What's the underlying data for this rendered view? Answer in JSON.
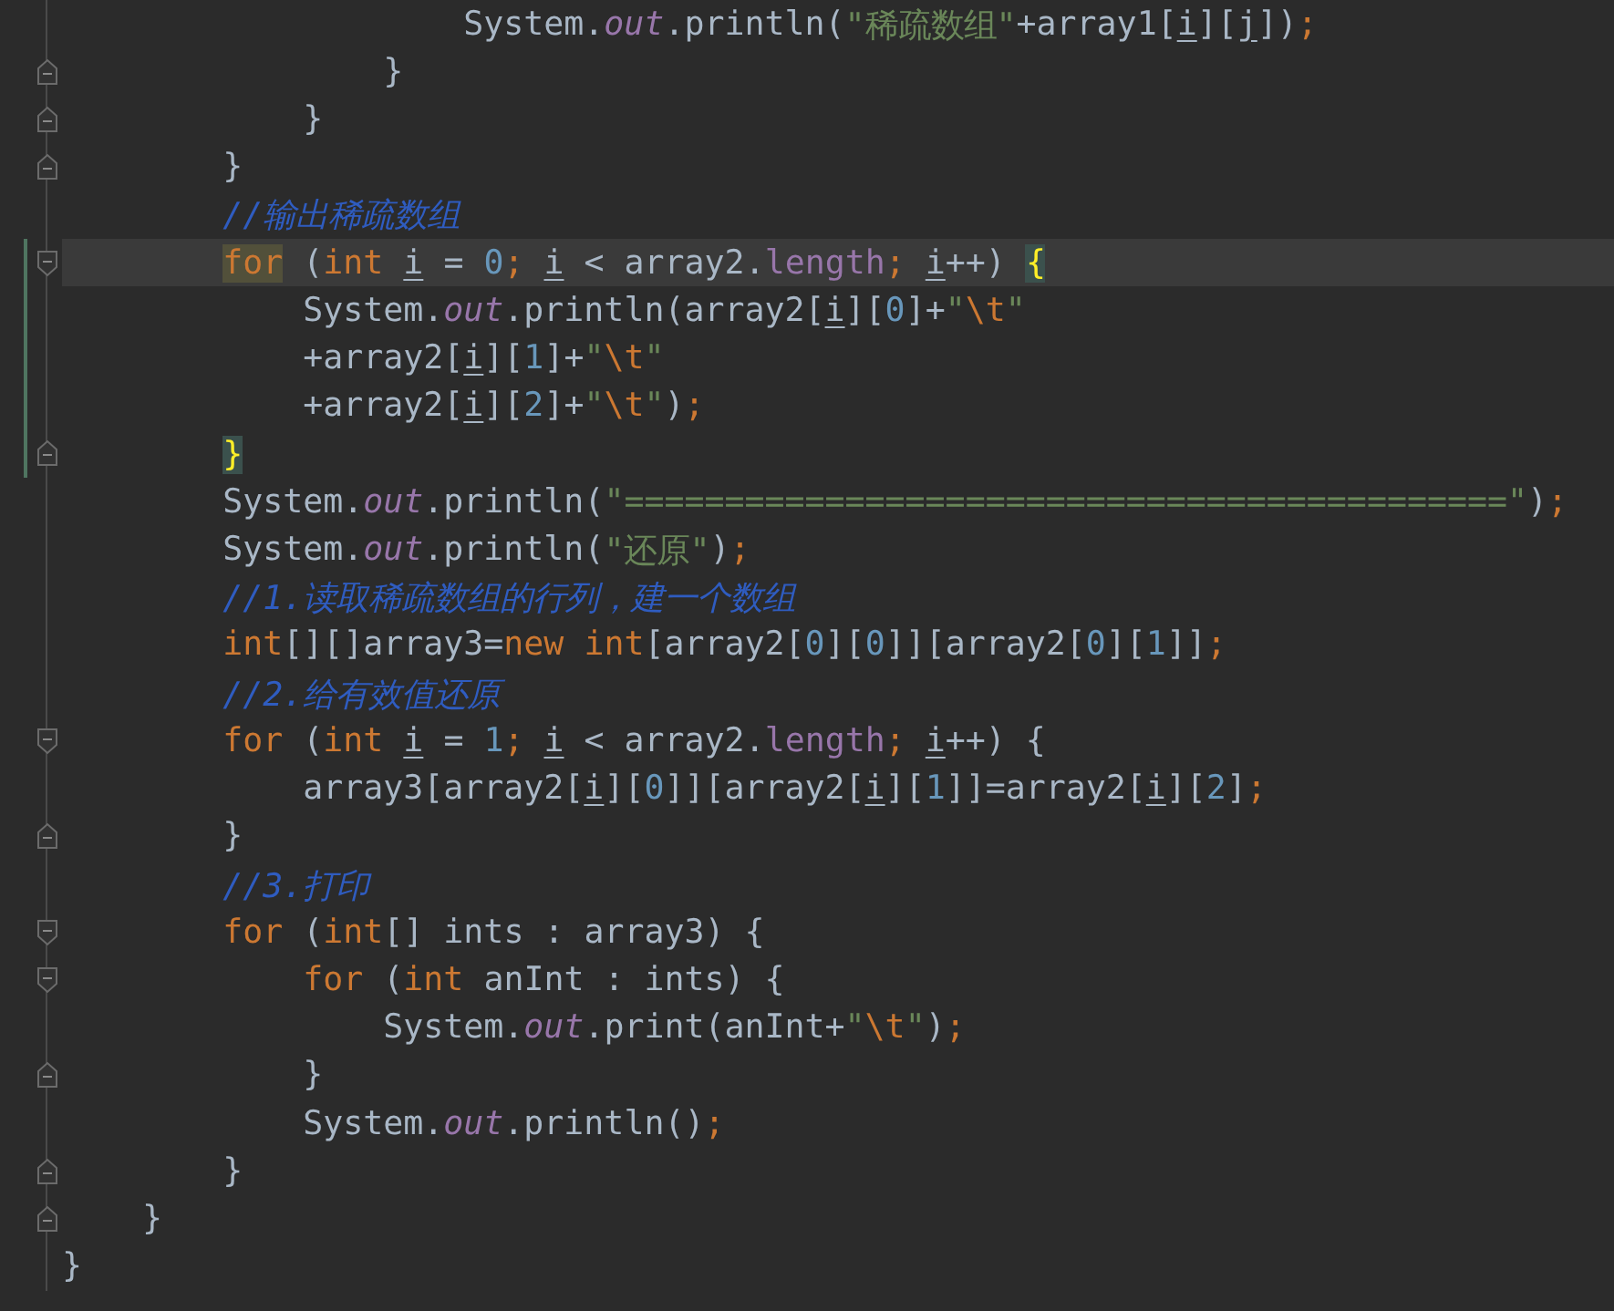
{
  "editor": {
    "lines": [
      {
        "fold_start": false,
        "fold_end": false,
        "changed": false,
        "current": false,
        "tokens": [
          {
            "text": "                    System.",
            "kind": "plain"
          },
          {
            "text": "out",
            "kind": "field"
          },
          {
            "text": ".println(",
            "kind": "plain"
          },
          {
            "text": "\"稀疏数组\"",
            "kind": "string"
          },
          {
            "text": "+array1[",
            "kind": "plain"
          },
          {
            "text": "i",
            "kind": "var"
          },
          {
            "text": "][",
            "kind": "plain"
          },
          {
            "text": "j",
            "kind": "var"
          },
          {
            "text": "])",
            "kind": "plain"
          },
          {
            "text": ";",
            "kind": "punct"
          }
        ]
      },
      {
        "fold_start": false,
        "fold_end": true,
        "changed": false,
        "current": false,
        "tokens": [
          {
            "text": "                }",
            "kind": "plain"
          }
        ]
      },
      {
        "fold_start": false,
        "fold_end": true,
        "changed": false,
        "current": false,
        "tokens": [
          {
            "text": "            }",
            "kind": "plain"
          }
        ]
      },
      {
        "fold_start": false,
        "fold_end": true,
        "changed": false,
        "current": false,
        "tokens": [
          {
            "text": "        }",
            "kind": "plain"
          }
        ]
      },
      {
        "fold_start": false,
        "fold_end": false,
        "changed": false,
        "current": false,
        "tokens": [
          {
            "text": "        //输出稀疏数组",
            "kind": "comment"
          }
        ]
      },
      {
        "fold_start": true,
        "fold_end": false,
        "changed": true,
        "current": true,
        "tokens": [
          {
            "text": "        for",
            "kind": "keyword-usage"
          },
          {
            "text": " (",
            "kind": "plain"
          },
          {
            "text": "int ",
            "kind": "keyword"
          },
          {
            "text": "i",
            "kind": "var"
          },
          {
            "text": " = ",
            "kind": "plain"
          },
          {
            "text": "0",
            "kind": "number"
          },
          {
            "text": "; ",
            "kind": "punct"
          },
          {
            "text": "i",
            "kind": "var"
          },
          {
            "text": " < array2.",
            "kind": "plain"
          },
          {
            "text": "length",
            "kind": "property"
          },
          {
            "text": "; ",
            "kind": "punct"
          },
          {
            "text": "i",
            "kind": "var"
          },
          {
            "text": "++) ",
            "kind": "plain"
          },
          {
            "text": "{",
            "kind": "brace-match"
          }
        ]
      },
      {
        "fold_start": false,
        "fold_end": false,
        "changed": true,
        "current": false,
        "tokens": [
          {
            "text": "            System.",
            "kind": "plain"
          },
          {
            "text": "out",
            "kind": "field"
          },
          {
            "text": ".println(array2[",
            "kind": "plain"
          },
          {
            "text": "i",
            "kind": "var"
          },
          {
            "text": "][",
            "kind": "plain"
          },
          {
            "text": "0",
            "kind": "number"
          },
          {
            "text": "]+",
            "kind": "plain"
          },
          {
            "text": "\"",
            "kind": "string"
          },
          {
            "text": "\\t",
            "kind": "escape"
          },
          {
            "text": "\"",
            "kind": "string"
          }
        ]
      },
      {
        "fold_start": false,
        "fold_end": false,
        "changed": true,
        "current": false,
        "tokens": [
          {
            "text": "            +array2[",
            "kind": "plain"
          },
          {
            "text": "i",
            "kind": "var"
          },
          {
            "text": "][",
            "kind": "plain"
          },
          {
            "text": "1",
            "kind": "number"
          },
          {
            "text": "]+",
            "kind": "plain"
          },
          {
            "text": "\"",
            "kind": "string"
          },
          {
            "text": "\\t",
            "kind": "escape"
          },
          {
            "text": "\"",
            "kind": "string"
          }
        ]
      },
      {
        "fold_start": false,
        "fold_end": false,
        "changed": true,
        "current": false,
        "tokens": [
          {
            "text": "            +array2[",
            "kind": "plain"
          },
          {
            "text": "i",
            "kind": "var"
          },
          {
            "text": "][",
            "kind": "plain"
          },
          {
            "text": "2",
            "kind": "number"
          },
          {
            "text": "]+",
            "kind": "plain"
          },
          {
            "text": "\"",
            "kind": "string"
          },
          {
            "text": "\\t",
            "kind": "escape"
          },
          {
            "text": "\"",
            "kind": "string"
          },
          {
            "text": ")",
            "kind": "plain"
          },
          {
            "text": ";",
            "kind": "punct"
          }
        ]
      },
      {
        "fold_start": false,
        "fold_end": true,
        "changed": true,
        "current": false,
        "tokens": [
          {
            "text": "        }",
            "kind": "brace-match"
          }
        ]
      },
      {
        "fold_start": false,
        "fold_end": false,
        "changed": false,
        "current": false,
        "tokens": [
          {
            "text": "        System.",
            "kind": "plain"
          },
          {
            "text": "out",
            "kind": "field"
          },
          {
            "text": ".println(",
            "kind": "plain"
          },
          {
            "text": "\"============================================\"",
            "kind": "string"
          },
          {
            "text": ")",
            "kind": "plain"
          },
          {
            "text": ";",
            "kind": "punct"
          }
        ]
      },
      {
        "fold_start": false,
        "fold_end": false,
        "changed": false,
        "current": false,
        "tokens": [
          {
            "text": "        System.",
            "kind": "plain"
          },
          {
            "text": "out",
            "kind": "field"
          },
          {
            "text": ".println(",
            "kind": "plain"
          },
          {
            "text": "\"还原\"",
            "kind": "string"
          },
          {
            "text": ")",
            "kind": "plain"
          },
          {
            "text": ";",
            "kind": "punct"
          }
        ]
      },
      {
        "fold_start": false,
        "fold_end": false,
        "changed": false,
        "current": false,
        "tokens": [
          {
            "text": "        //1.读取稀疏数组的行列，建一个数组",
            "kind": "comment"
          }
        ]
      },
      {
        "fold_start": false,
        "fold_end": false,
        "changed": false,
        "current": false,
        "tokens": [
          {
            "text": "        int",
            "kind": "keyword"
          },
          {
            "text": "[][]array3=",
            "kind": "plain"
          },
          {
            "text": "new int",
            "kind": "keyword"
          },
          {
            "text": "[array2[",
            "kind": "plain"
          },
          {
            "text": "0",
            "kind": "number"
          },
          {
            "text": "][",
            "kind": "plain"
          },
          {
            "text": "0",
            "kind": "number"
          },
          {
            "text": "]][array2[",
            "kind": "plain"
          },
          {
            "text": "0",
            "kind": "number"
          },
          {
            "text": "][",
            "kind": "plain"
          },
          {
            "text": "1",
            "kind": "number"
          },
          {
            "text": "]]",
            "kind": "plain"
          },
          {
            "text": ";",
            "kind": "punct"
          }
        ]
      },
      {
        "fold_start": false,
        "fold_end": false,
        "changed": false,
        "current": false,
        "tokens": [
          {
            "text": "        //2.给有效值还原",
            "kind": "comment"
          }
        ]
      },
      {
        "fold_start": true,
        "fold_end": false,
        "changed": false,
        "current": false,
        "tokens": [
          {
            "text": "        for",
            "kind": "keyword"
          },
          {
            "text": " (",
            "kind": "plain"
          },
          {
            "text": "int ",
            "kind": "keyword"
          },
          {
            "text": "i",
            "kind": "var"
          },
          {
            "text": " = ",
            "kind": "plain"
          },
          {
            "text": "1",
            "kind": "number"
          },
          {
            "text": "; ",
            "kind": "punct"
          },
          {
            "text": "i",
            "kind": "var"
          },
          {
            "text": " < array2.",
            "kind": "plain"
          },
          {
            "text": "length",
            "kind": "property"
          },
          {
            "text": "; ",
            "kind": "punct"
          },
          {
            "text": "i",
            "kind": "var"
          },
          {
            "text": "++) {",
            "kind": "plain"
          }
        ]
      },
      {
        "fold_start": false,
        "fold_end": false,
        "changed": false,
        "current": false,
        "tokens": [
          {
            "text": "            array3[array2[",
            "kind": "plain"
          },
          {
            "text": "i",
            "kind": "var"
          },
          {
            "text": "][",
            "kind": "plain"
          },
          {
            "text": "0",
            "kind": "number"
          },
          {
            "text": "]][array2[",
            "kind": "plain"
          },
          {
            "text": "i",
            "kind": "var"
          },
          {
            "text": "][",
            "kind": "plain"
          },
          {
            "text": "1",
            "kind": "number"
          },
          {
            "text": "]]=array2[",
            "kind": "plain"
          },
          {
            "text": "i",
            "kind": "var"
          },
          {
            "text": "][",
            "kind": "plain"
          },
          {
            "text": "2",
            "kind": "number"
          },
          {
            "text": "]",
            "kind": "plain"
          },
          {
            "text": ";",
            "kind": "punct"
          }
        ]
      },
      {
        "fold_start": false,
        "fold_end": true,
        "changed": false,
        "current": false,
        "tokens": [
          {
            "text": "        }",
            "kind": "plain"
          }
        ]
      },
      {
        "fold_start": false,
        "fold_end": false,
        "changed": false,
        "current": false,
        "tokens": [
          {
            "text": "        //3.打印",
            "kind": "comment"
          }
        ]
      },
      {
        "fold_start": true,
        "fold_end": false,
        "changed": false,
        "current": false,
        "tokens": [
          {
            "text": "        for",
            "kind": "keyword"
          },
          {
            "text": " (",
            "kind": "plain"
          },
          {
            "text": "int",
            "kind": "keyword"
          },
          {
            "text": "[] ints : array3) {",
            "kind": "plain"
          }
        ]
      },
      {
        "fold_start": true,
        "fold_end": false,
        "changed": false,
        "current": false,
        "tokens": [
          {
            "text": "            for",
            "kind": "keyword"
          },
          {
            "text": " (",
            "kind": "plain"
          },
          {
            "text": "int",
            "kind": "keyword"
          },
          {
            "text": " anInt : ints) {",
            "kind": "plain"
          }
        ]
      },
      {
        "fold_start": false,
        "fold_end": false,
        "changed": false,
        "current": false,
        "tokens": [
          {
            "text": "                System.",
            "kind": "plain"
          },
          {
            "text": "out",
            "kind": "field"
          },
          {
            "text": ".print(anInt+",
            "kind": "plain"
          },
          {
            "text": "\"",
            "kind": "string"
          },
          {
            "text": "\\t",
            "kind": "escape"
          },
          {
            "text": "\"",
            "kind": "string"
          },
          {
            "text": ")",
            "kind": "plain"
          },
          {
            "text": ";",
            "kind": "punct"
          }
        ]
      },
      {
        "fold_start": false,
        "fold_end": true,
        "changed": false,
        "current": false,
        "tokens": [
          {
            "text": "            }",
            "kind": "plain"
          }
        ]
      },
      {
        "fold_start": false,
        "fold_end": false,
        "changed": false,
        "current": false,
        "tokens": [
          {
            "text": "            System.",
            "kind": "plain"
          },
          {
            "text": "out",
            "kind": "field"
          },
          {
            "text": ".println()",
            "kind": "plain"
          },
          {
            "text": ";",
            "kind": "punct"
          }
        ]
      },
      {
        "fold_start": false,
        "fold_end": true,
        "changed": false,
        "current": false,
        "tokens": [
          {
            "text": "        }",
            "kind": "plain"
          }
        ]
      },
      {
        "fold_start": false,
        "fold_end": true,
        "changed": false,
        "current": false,
        "tokens": [
          {
            "text": "    }",
            "kind": "plain"
          }
        ]
      },
      {
        "fold_start": false,
        "fold_end": false,
        "changed": false,
        "current": false,
        "tokens": [
          {
            "text": "}",
            "kind": "plain"
          }
        ]
      }
    ]
  }
}
